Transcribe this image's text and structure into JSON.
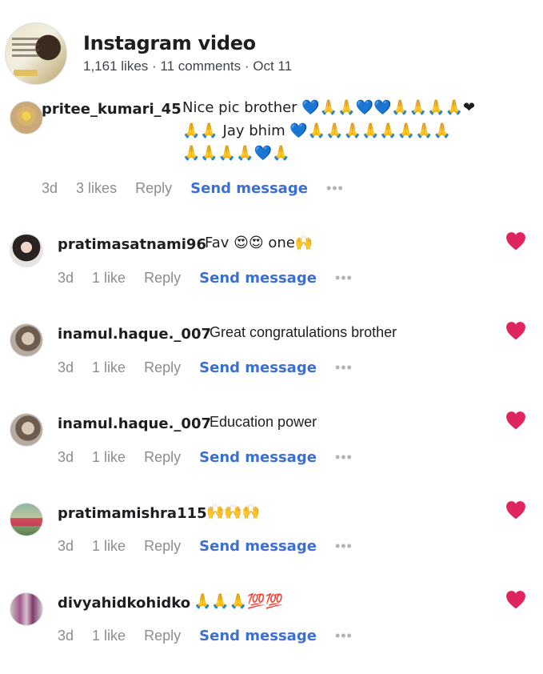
{
  "post": {
    "title": "Instagram video",
    "meta": "1,161 likes · 11 comments · Oct 11"
  },
  "comments": [
    {
      "username": "pritee_kumari_45",
      "line1": "Nice pic brother 💙🙏🙏💙💙🙏🙏🙏🙏❤",
      "line2": "🙏🙏 Jay bhim 💙🙏🙏🙏🙏🙏🙏🙏🙏",
      "line3": "🙏🙏🙏🙏💙🙏",
      "time": "3d",
      "likes": "3 likes",
      "reply": "Reply",
      "send": "Send message",
      "more": "•••"
    },
    {
      "username": "pratimasatnami96",
      "text": "Fav 😍😍 one🙌",
      "time": "3d",
      "likes": "1 like",
      "reply": "Reply",
      "send": "Send message",
      "more": "•••"
    },
    {
      "username": "inamul.haque._007",
      "text": "Great congratulations brother",
      "time": "3d",
      "likes": "1 like",
      "reply": "Reply",
      "send": "Send message",
      "more": "•••"
    },
    {
      "username": "inamul.haque._007",
      "text": "Education power",
      "time": "3d",
      "likes": "1 like",
      "reply": "Reply",
      "send": "Send message",
      "more": "•••"
    },
    {
      "username": "pratimamishra115",
      "text": "🙌🙌🙌",
      "time": "3d",
      "likes": "1 like",
      "reply": "Reply",
      "send": "Send message",
      "more": "•••"
    },
    {
      "username": "divyahidkohidko",
      "text": "🙏🙏🙏💯💯",
      "time": "3d",
      "likes": "1 like",
      "reply": "Reply",
      "send": "Send message",
      "more": "•••"
    }
  ],
  "colors": {
    "heart": "#e0245e",
    "link": "#3b6fd2",
    "muted": "#8a8d91"
  }
}
